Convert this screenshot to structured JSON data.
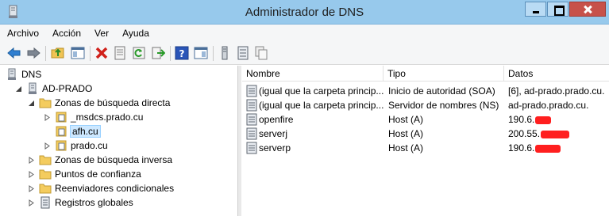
{
  "window": {
    "title": "Administrador de DNS"
  },
  "menu": [
    "Archivo",
    "Acción",
    "Ver",
    "Ayuda"
  ],
  "toolbar": {
    "buttons": [
      "back-icon",
      "forward-icon",
      "up-folder-icon",
      "show-hide-tree-icon",
      "delete-icon",
      "properties-icon",
      "refresh-icon",
      "export-icon",
      "help-icon",
      "console-icon",
      "server-icon",
      "records-icon",
      "copy-icon"
    ]
  },
  "tree": {
    "root": "DNS",
    "server": "AD-PRADO",
    "forward_zones": "Zonas de búsqueda directa",
    "zone_msdcs": "_msdcs.prado.cu",
    "zone_afh": "afh.cu",
    "zone_prado": "prado.cu",
    "reverse_zones": "Zonas de búsqueda inversa",
    "trust_points": "Puntos de confianza",
    "conditional_forwarders": "Reenviadores condicionales",
    "global_logs": "Registros globales"
  },
  "list": {
    "columns": [
      "Nombre",
      "Tipo",
      "Datos"
    ],
    "rows": [
      {
        "name": "(igual que la carpeta princip...",
        "type": "Inicio de autoridad (SOA)",
        "data": "[6], ad-prado.prado.cu."
      },
      {
        "name": "(igual que la carpeta princip...",
        "type": "Servidor de nombres (NS)",
        "data": "ad-prado.prado.cu."
      },
      {
        "name": "openfire",
        "type": "Host (A)",
        "data": "190.6."
      },
      {
        "name": "serverj",
        "type": "Host (A)",
        "data": "200.55."
      },
      {
        "name": "serverp",
        "type": "Host (A)",
        "data": "190.6."
      }
    ]
  },
  "colors": {
    "titlebar": "#97c9ec",
    "selection": "#cde8ff",
    "redaction": "#ff1f1f"
  }
}
